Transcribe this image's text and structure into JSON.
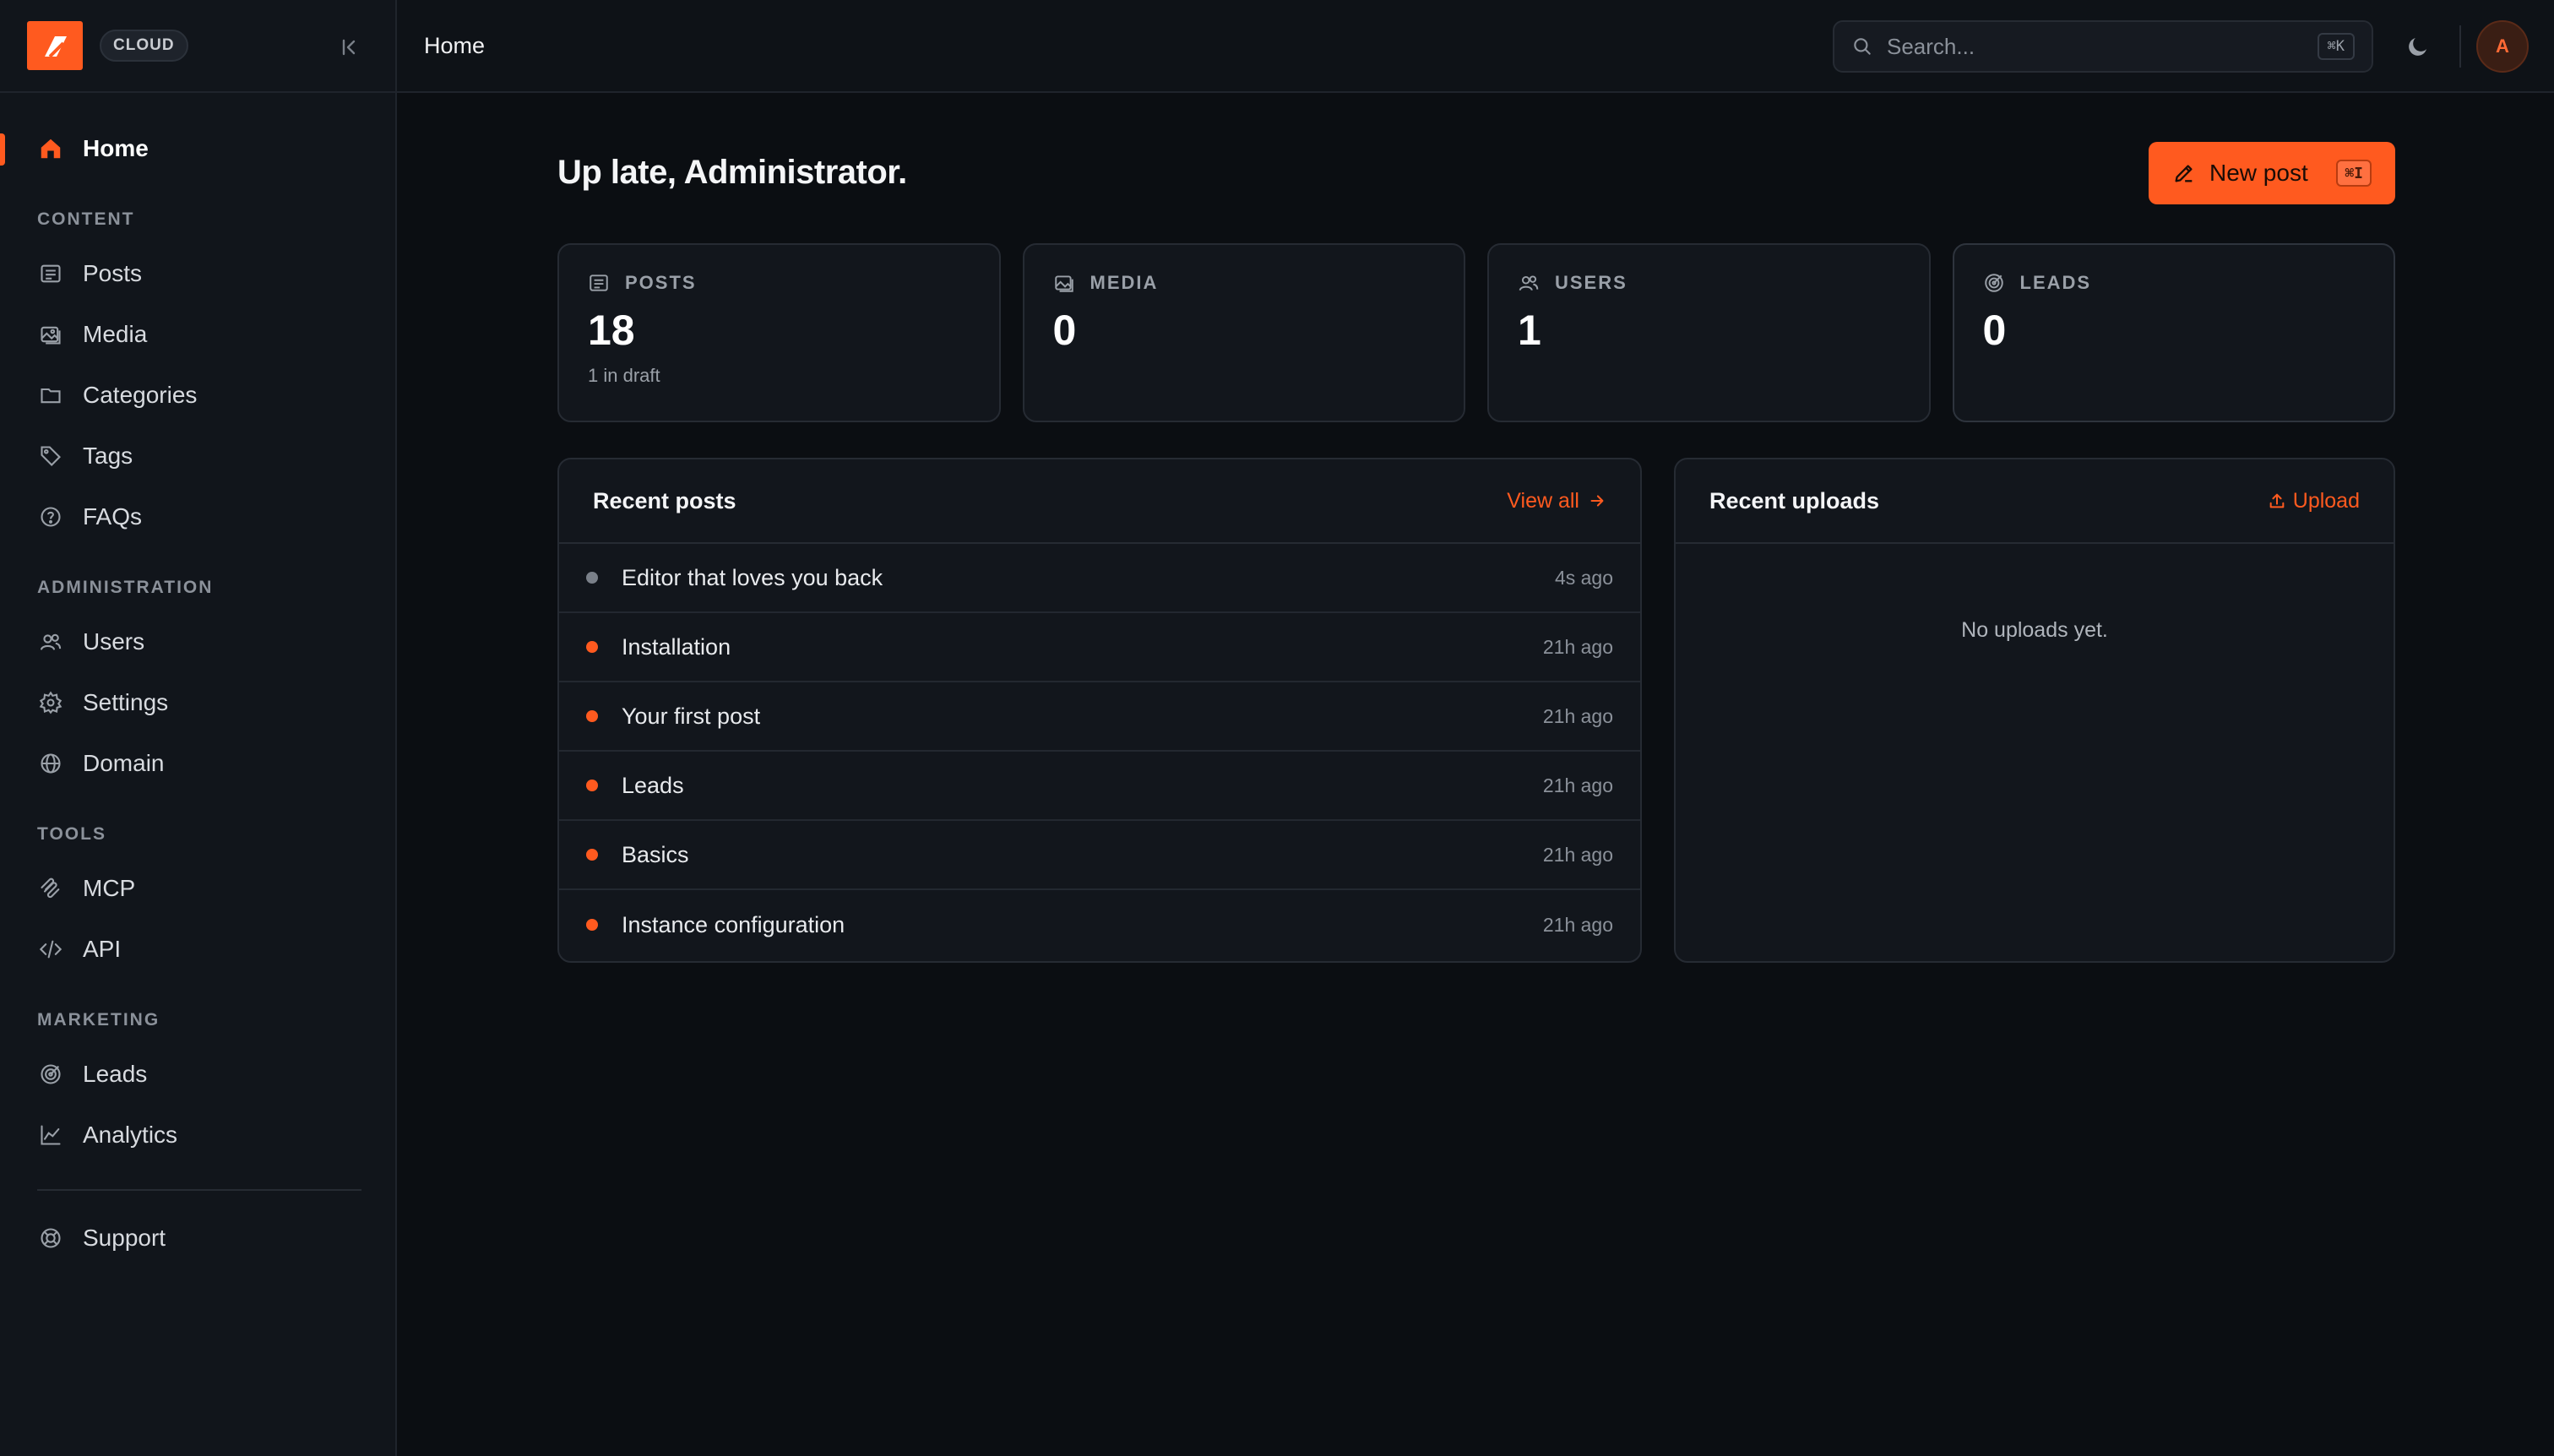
{
  "brand": {
    "badge": "CLOUD",
    "accent": "#ff5a1f"
  },
  "sidebar": {
    "home": "Home",
    "sections": [
      {
        "title": "CONTENT",
        "items": [
          {
            "label": "Posts",
            "icon": "posts-icon"
          },
          {
            "label": "Media",
            "icon": "media-icon"
          },
          {
            "label": "Categories",
            "icon": "folder-icon"
          },
          {
            "label": "Tags",
            "icon": "tag-icon"
          },
          {
            "label": "FAQs",
            "icon": "help-icon"
          }
        ]
      },
      {
        "title": "ADMINISTRATION",
        "items": [
          {
            "label": "Users",
            "icon": "users-icon"
          },
          {
            "label": "Settings",
            "icon": "gear-icon"
          },
          {
            "label": "Domain",
            "icon": "globe-icon"
          }
        ]
      },
      {
        "title": "TOOLS",
        "items": [
          {
            "label": "MCP",
            "icon": "mcp-icon"
          },
          {
            "label": "API",
            "icon": "code-icon"
          }
        ]
      },
      {
        "title": "MARKETING",
        "items": [
          {
            "label": "Leads",
            "icon": "target-icon"
          },
          {
            "label": "Analytics",
            "icon": "chart-icon"
          }
        ]
      }
    ],
    "support": "Support"
  },
  "topbar": {
    "breadcrumb": "Home",
    "search_placeholder": "Search...",
    "search_shortcut": "⌘K",
    "avatar_initial": "A"
  },
  "main": {
    "greeting": "Up late, Administrator.",
    "new_post": {
      "label": "New post",
      "shortcut": "⌘I"
    },
    "stats": [
      {
        "label": "POSTS",
        "value": "18",
        "sub": "1 in draft"
      },
      {
        "label": "MEDIA",
        "value": "0",
        "sub": ""
      },
      {
        "label": "USERS",
        "value": "1",
        "sub": ""
      },
      {
        "label": "LEADS",
        "value": "0",
        "sub": ""
      }
    ],
    "recent_posts": {
      "title": "Recent posts",
      "link": "View all",
      "rows": [
        {
          "title": "Editor that loves you back",
          "time": "4s ago",
          "status": "draft"
        },
        {
          "title": "Installation",
          "time": "21h ago",
          "status": "published"
        },
        {
          "title": "Your first post",
          "time": "21h ago",
          "status": "published"
        },
        {
          "title": "Leads",
          "time": "21h ago",
          "status": "published"
        },
        {
          "title": "Basics",
          "time": "21h ago",
          "status": "published"
        },
        {
          "title": "Instance configuration",
          "time": "21h ago",
          "status": "published"
        }
      ]
    },
    "recent_uploads": {
      "title": "Recent uploads",
      "link": "Upload",
      "empty": "No uploads yet."
    }
  }
}
